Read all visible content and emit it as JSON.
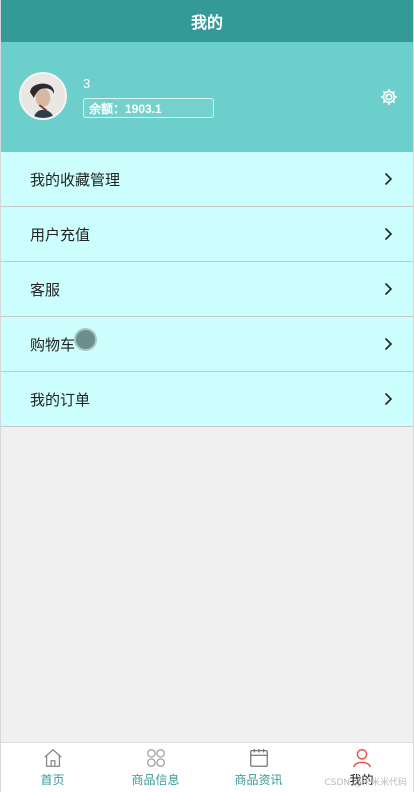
{
  "header": {
    "title": "我的"
  },
  "profile": {
    "username": "3",
    "balance_text": "余额：1903.1",
    "avatar_icon": "avatar-photo",
    "settings_icon": "gear-icon"
  },
  "menu": {
    "items": [
      {
        "label": "我的收藏管理"
      },
      {
        "label": "用户充值"
      },
      {
        "label": "客服"
      },
      {
        "label": "购物车"
      },
      {
        "label": "我的订单"
      }
    ]
  },
  "tabbar": {
    "items": [
      {
        "label": "首页",
        "icon": "home-icon"
      },
      {
        "label": "商品信息",
        "icon": "grid-icon"
      },
      {
        "label": "商品资讯",
        "icon": "calendar-icon"
      },
      {
        "label": "我的",
        "icon": "user-icon",
        "active": true
      }
    ]
  },
  "watermark": "CSDN @米米米代码",
  "colors": {
    "header_bg": "#339a97",
    "profile_bg": "#6dcfcb",
    "menu_bg": "#ccfefd",
    "tab_text": "#339a97",
    "active_icon": "#e8554e"
  }
}
